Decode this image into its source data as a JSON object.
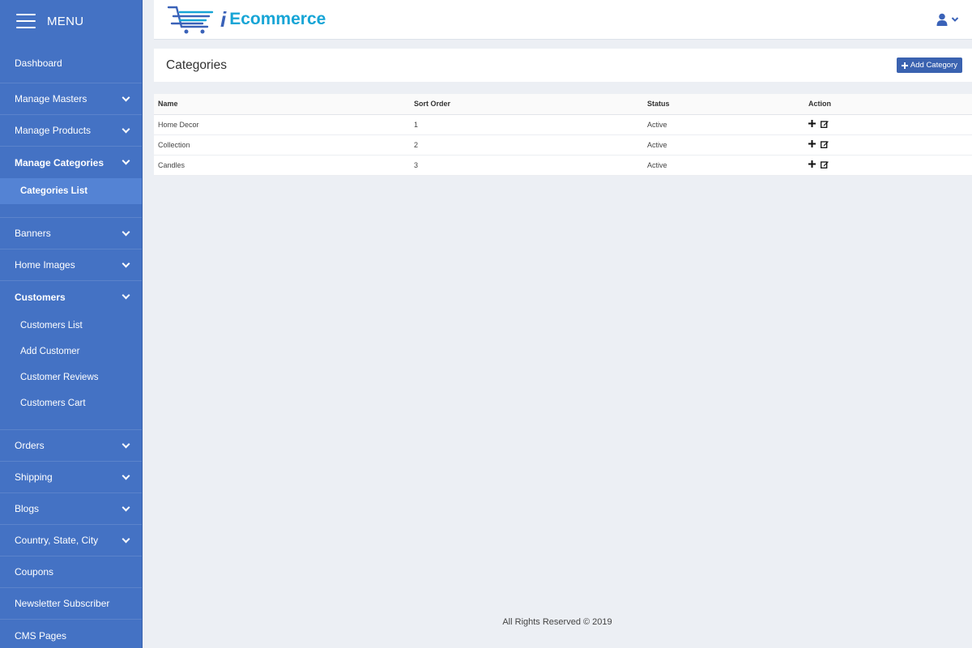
{
  "sidebar": {
    "menu_label": "MENU",
    "items": [
      {
        "label": "Dashboard"
      },
      {
        "label": "Manage Masters"
      },
      {
        "label": "Manage Products"
      },
      {
        "label": "Manage Categories"
      },
      {
        "label": "Banners"
      },
      {
        "label": "Home Images"
      },
      {
        "label": "Customers"
      },
      {
        "label": "Orders"
      },
      {
        "label": "Shipping"
      },
      {
        "label": "Blogs"
      },
      {
        "label": "Country, State, City"
      },
      {
        "label": "Coupons"
      },
      {
        "label": "Newsletter Subscriber"
      },
      {
        "label": "CMS Pages"
      }
    ],
    "categories_sub": [
      "Categories List"
    ],
    "customers_sub": [
      "Customers List",
      "Add Customer",
      "Customer Reviews",
      "Customers Cart"
    ]
  },
  "header": {
    "logo_text": "Ecommerce",
    "user_icon": "user-icon"
  },
  "page": {
    "title": "Categories",
    "add_button": "Add Category"
  },
  "table": {
    "columns": [
      "Name",
      "Sort Order",
      "Status",
      "Action"
    ],
    "rows": [
      {
        "name": "Home Decor",
        "sort": "1",
        "status": "Active"
      },
      {
        "name": "Collection",
        "sort": "2",
        "status": "Active"
      },
      {
        "name": "Candles",
        "sort": "3",
        "status": "Active"
      }
    ]
  },
  "footer": {
    "text": "All Rights Reserved © 2019"
  },
  "colors": {
    "sidebar_bg": "#4472c4",
    "active_sub_bg": "#5483d4",
    "logo_cyan": "#17a5d6",
    "logo_blue": "#3a62b8",
    "button_bg": "#3a62b0",
    "page_bg": "#eceff4"
  }
}
